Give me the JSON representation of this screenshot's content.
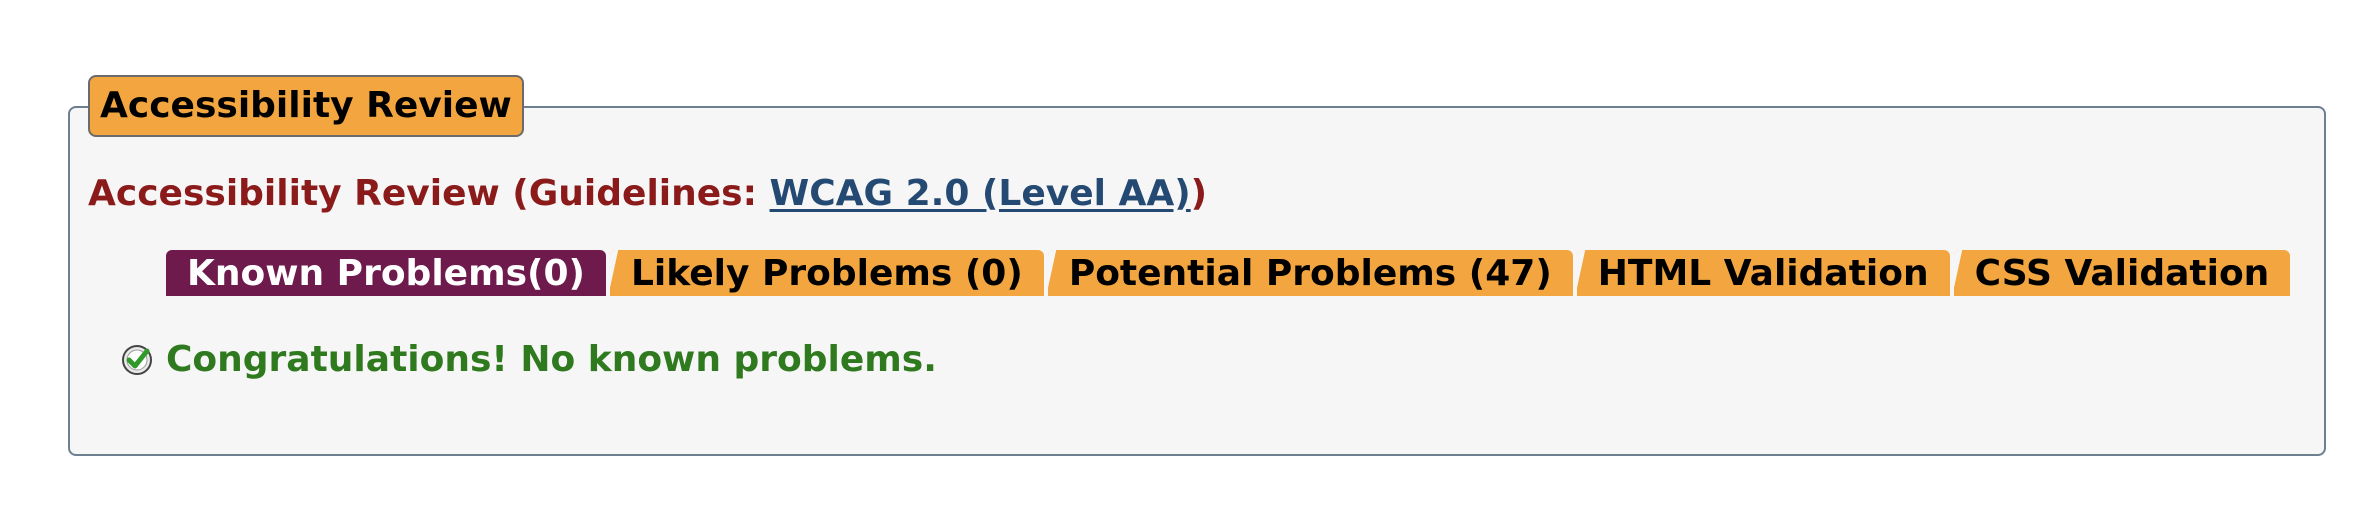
{
  "panel": {
    "legend": "Accessibility Review"
  },
  "guidelines": {
    "prefix": "Accessibility Review (Guidelines: ",
    "link_text": "WCAG 2.0 (Level AA)",
    "suffix": ")"
  },
  "tabs": [
    {
      "label": "Known Problems(0)",
      "active": true
    },
    {
      "label": "Likely Problems (0)",
      "active": false
    },
    {
      "label": "Potential Problems (47)",
      "active": false
    },
    {
      "label": "HTML Validation",
      "active": false
    },
    {
      "label": "CSS Validation",
      "active": false
    }
  ],
  "result": {
    "icon": "check-icon",
    "message": "Congratulations! No known problems."
  },
  "colors": {
    "legend_bg": "#f3a640",
    "tab_bg": "#f3a640",
    "tab_active_bg": "#6e1a4d",
    "heading": "#8b1a1a",
    "link": "#244a73",
    "success": "#2f7a1f",
    "panel_bg": "#f6f6f6"
  }
}
